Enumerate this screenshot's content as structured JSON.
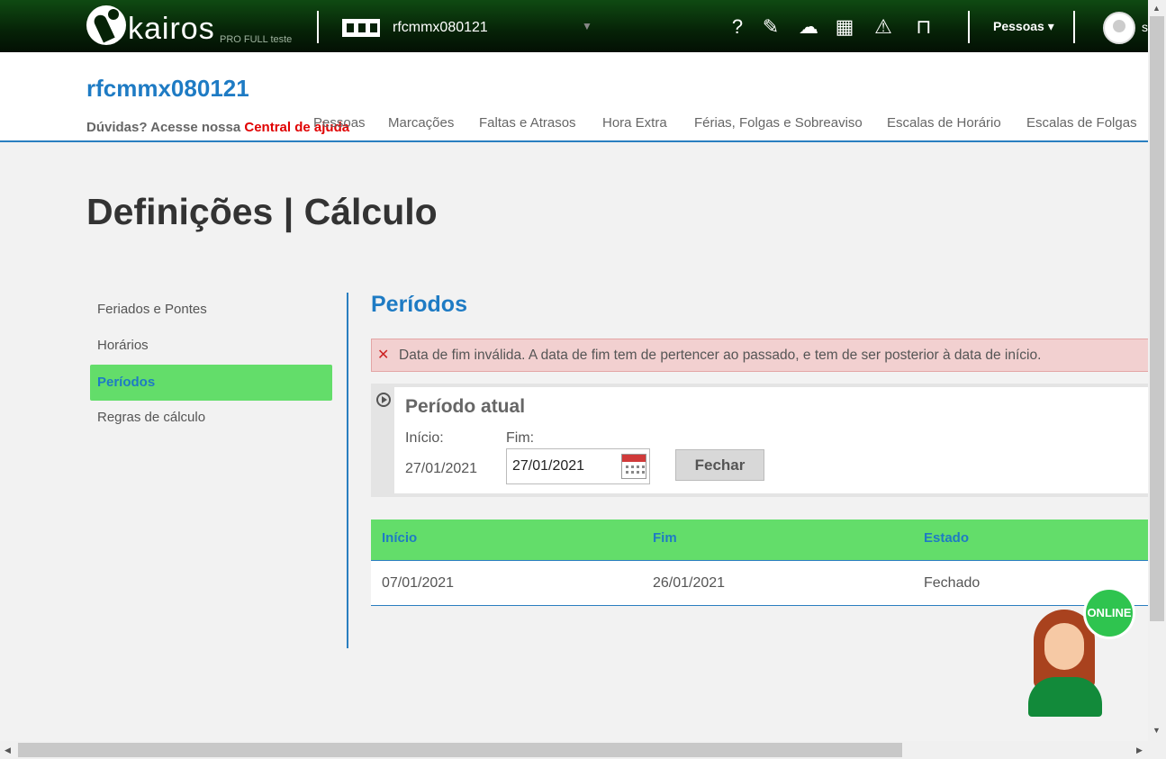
{
  "topbar": {
    "logo_text": "kairos",
    "logo_subtitle": "PRO FULL teste",
    "company_name": "rfcmmx080121",
    "user_menu_label": "Pessoas",
    "user_initial": "s",
    "icons": [
      "help-icon",
      "feedback-icon",
      "cloud-sync-icon",
      "calculator-icon",
      "warning-icon",
      "inbox-icon"
    ]
  },
  "header": {
    "title": "rfcmmx080121",
    "help_prefix": "Dúvidas? Acesse nossa",
    "help_link": "Central de ajuda",
    "nav": [
      "Pessoas",
      "Marcações",
      "Faltas e Atrasos",
      "Hora Extra",
      "Férias, Folgas e Sobreaviso",
      "Escalas de Horário",
      "Escalas de Folgas"
    ]
  },
  "page_title": "Definições | Cálculo",
  "sidebar": {
    "items": [
      {
        "label": "Feriados e Pontes"
      },
      {
        "label": "Horários"
      },
      {
        "label": "Períodos"
      },
      {
        "label": "Regras de cálculo"
      }
    ],
    "active": "Períodos"
  },
  "section": {
    "title": "Períodos",
    "error_message": "Data de fim inválida. A data de fim tem de pertencer ao passado, e tem de ser posterior à data de início.",
    "current_period": {
      "title": "Período atual",
      "start_label": "Início:",
      "end_label": "Fim:",
      "start_value": "27/01/2021",
      "end_value": "27/01/2021",
      "close_button": "Fechar"
    },
    "table": {
      "columns": [
        "Início",
        "Fim",
        "Estado"
      ],
      "rows": [
        [
          "07/01/2021",
          "26/01/2021",
          "Fechado"
        ]
      ]
    }
  },
  "chat": {
    "badge": "ONLINE"
  },
  "colors": {
    "accent_blue": "#1e7bc4",
    "active_green": "#63dd6a",
    "error_bg": "#f2d0d0",
    "help_link_red": "#e00000"
  }
}
